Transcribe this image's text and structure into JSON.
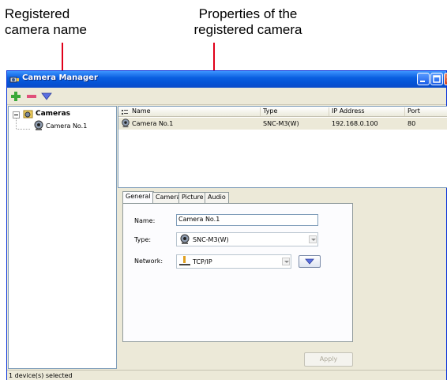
{
  "annotations": {
    "left_line1": "Registered",
    "left_line2": "camera name",
    "right_line1": "Properties of the",
    "right_line2": "registered camera"
  },
  "window": {
    "title": "Camera Manager"
  },
  "toolbar": {
    "icons": [
      "add-icon",
      "remove-icon",
      "filter-icon"
    ]
  },
  "tree": {
    "root_label": "Cameras",
    "child_label": "Camera No.1"
  },
  "list": {
    "columns": [
      "Name",
      "Type",
      "IP Address",
      "Port"
    ],
    "rows": [
      {
        "name": "Camera No.1",
        "type": "SNC-M3(W)",
        "ip": "192.168.0.100",
        "port": "80"
      }
    ]
  },
  "tabs": [
    "General",
    "Camera",
    "Picture",
    "Audio"
  ],
  "general": {
    "name_label": "Name:",
    "name_value": "Camera No.1",
    "type_label": "Type:",
    "type_value": "SNC-M3(W)",
    "network_label": "Network:",
    "network_value": "TCP/IP"
  },
  "apply_label": "Apply",
  "status": "1 device(s) selected",
  "colors": {
    "pointer": "#e0001a",
    "titlebar": "#0553d6"
  }
}
